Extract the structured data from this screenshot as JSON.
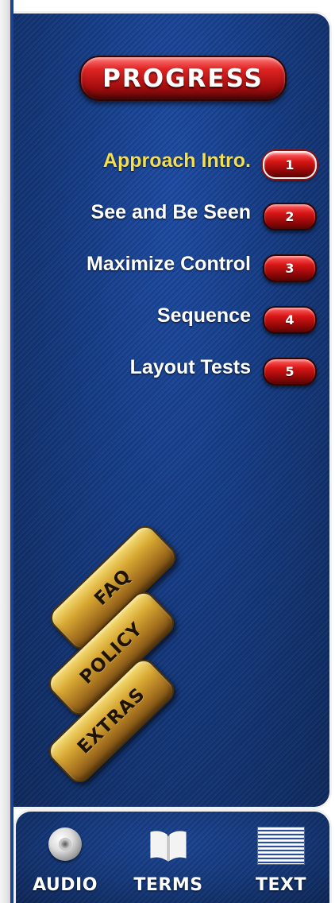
{
  "progress": {
    "title": "PROGRESS"
  },
  "steps": [
    {
      "label": "Approach Intro.",
      "number": "1",
      "active": true
    },
    {
      "label": "See and Be Seen",
      "number": "2",
      "active": false
    },
    {
      "label": "Maximize Control",
      "number": "3",
      "active": false
    },
    {
      "label": "Sequence",
      "number": "4",
      "active": false
    },
    {
      "label": "Layout Tests",
      "number": "5",
      "active": false
    }
  ],
  "tabs": {
    "faq": "FAQ",
    "policy": "POLICY",
    "extras": "EXTRAS"
  },
  "bottom": {
    "audio": "AUDIO",
    "terms": "TERMS",
    "text": "TEXT"
  },
  "colors": {
    "panel_blue": "#173e88",
    "active_text": "#f3df52",
    "pill_red": "#d91616",
    "gold": "#d8a833"
  },
  "icons": {
    "audio": "speaker-disc-icon",
    "terms": "open-book-icon",
    "text": "document-text-icon"
  }
}
